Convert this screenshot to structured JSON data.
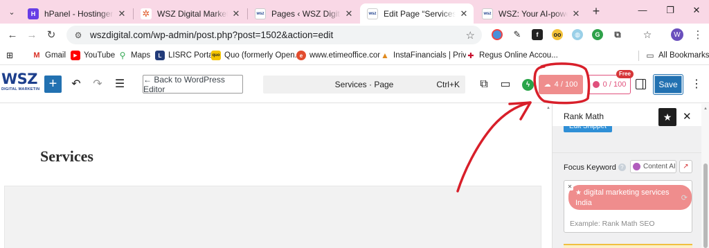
{
  "browser": {
    "tabs": [
      {
        "title": "hPanel - Hostinger",
        "icon": "hostinger-icon",
        "active": false
      },
      {
        "title": "WSZ Digital Marketing w",
        "icon": "wsz-settings-icon",
        "active": false
      },
      {
        "title": "Pages ‹ WSZ Digital Mark",
        "icon": "wsz-icon",
        "active": false
      },
      {
        "title": "Edit Page “Services” ‹ WS",
        "icon": "wsz-icon",
        "active": true
      },
      {
        "title": "WSZ: Your AI-powered di",
        "icon": "wsz-icon",
        "active": false
      }
    ],
    "url": "wszdigital.com/wp-admin/post.php?post=1502&action=edit",
    "bookmarks": [
      {
        "label": "Gmail",
        "icon": "gmail-icon"
      },
      {
        "label": "YouTube",
        "icon": "youtube-icon"
      },
      {
        "label": "Maps",
        "icon": "maps-icon"
      },
      {
        "label": "LISRC Portal",
        "icon": "lisrc-icon"
      },
      {
        "label": "Quo (formerly Open...",
        "icon": "quo-icon"
      },
      {
        "label": "www.etimeoffice.com",
        "icon": "etimeoffice-icon"
      },
      {
        "label": "InstaFinancials | Priv...",
        "icon": "instafinancials-icon"
      },
      {
        "label": "Regus Online Accou...",
        "icon": "regus-icon"
      }
    ],
    "all_bookmarks_label": "All Bookmarks",
    "profile_initial": "W"
  },
  "editor": {
    "logo_text": "WSZ",
    "logo_sub": "DIGITAL MARKETIN",
    "back_label": "← Back to WordPress Editor",
    "command_title": "Services · Page",
    "command_shortcut": "Ctrl+K",
    "rank_math_score": "4 / 100",
    "content_ai_score": "0 / 100",
    "free_badge": "Free",
    "save_label": "Save",
    "page_title": "Services"
  },
  "sidebar": {
    "title": "Rank Math",
    "edit_snippet_label": "Edit Snippet",
    "focus_keyword_label": "Focus Keyword",
    "content_ai_label": "Content AI",
    "keyword_line1": "digital marketing services",
    "keyword_line2": "India",
    "keyword_placeholder": "Example: Rank Math SEO"
  },
  "colors": {
    "tabstrip_bg": "#f9d8e6",
    "wp_blue": "#2271b1",
    "score_red": "#ef8d8d",
    "content_ai_pink": "#e0507c",
    "annotation_red": "#d81f2a"
  }
}
